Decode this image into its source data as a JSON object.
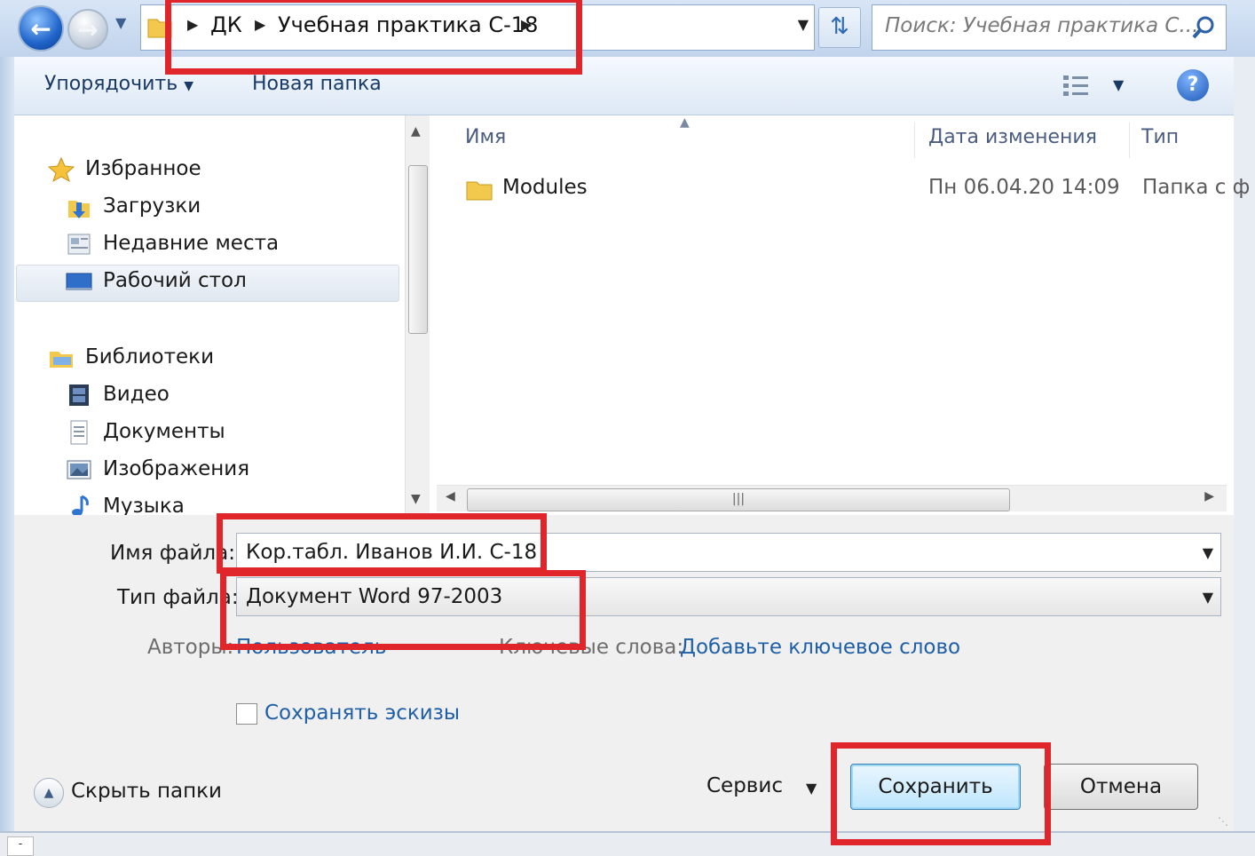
{
  "address_bar": {
    "breadcrumbs": [
      "ДК",
      "Учебная практика С-18"
    ],
    "search_placeholder": "Поиск: Учебная практика С..."
  },
  "toolbar": {
    "organize_label": "Упорядочить",
    "new_folder_label": "Новая папка"
  },
  "nav_pane": {
    "favorites": {
      "label": "Избранное",
      "items": [
        {
          "label": "Загрузки",
          "icon": "downloads-icon"
        },
        {
          "label": "Недавние места",
          "icon": "recent-places-icon"
        },
        {
          "label": "Рабочий стол",
          "icon": "desktop-icon",
          "selected": true
        }
      ]
    },
    "libraries": {
      "label": "Библиотеки",
      "items": [
        {
          "label": "Видео",
          "icon": "video-icon"
        },
        {
          "label": "Документы",
          "icon": "documents-icon"
        },
        {
          "label": "Изображения",
          "icon": "pictures-icon"
        },
        {
          "label": "Музыка",
          "icon": "music-icon"
        }
      ]
    }
  },
  "file_list": {
    "columns": [
      "Имя",
      "Дата изменения",
      "Тип"
    ],
    "rows": [
      {
        "name": "Modules",
        "date": "Пн 06.04.20 14:09",
        "type": "Папка с ф"
      }
    ]
  },
  "form": {
    "filename_label": "Имя файла:",
    "filename_value": "Кор.табл. Иванов И.И. С-18",
    "filetype_label": "Тип файла:",
    "filetype_value": "Документ Word 97-2003",
    "authors_label": "Авторы:",
    "authors_value": "Пользователь",
    "keywords_label": "Ключевые слова:",
    "keywords_value": "Добавьте ключевое слово",
    "save_thumbnails_label": "Сохранять эскизы",
    "save_thumbnails_checked": false
  },
  "footer": {
    "hide_folders_label": "Скрыть папки",
    "service_label": "Сервис",
    "save_label": "Сохранить",
    "cancel_label": "Отмена"
  },
  "colors": {
    "annotation_red": "#e0262b",
    "link_blue": "#1f5fa8"
  }
}
